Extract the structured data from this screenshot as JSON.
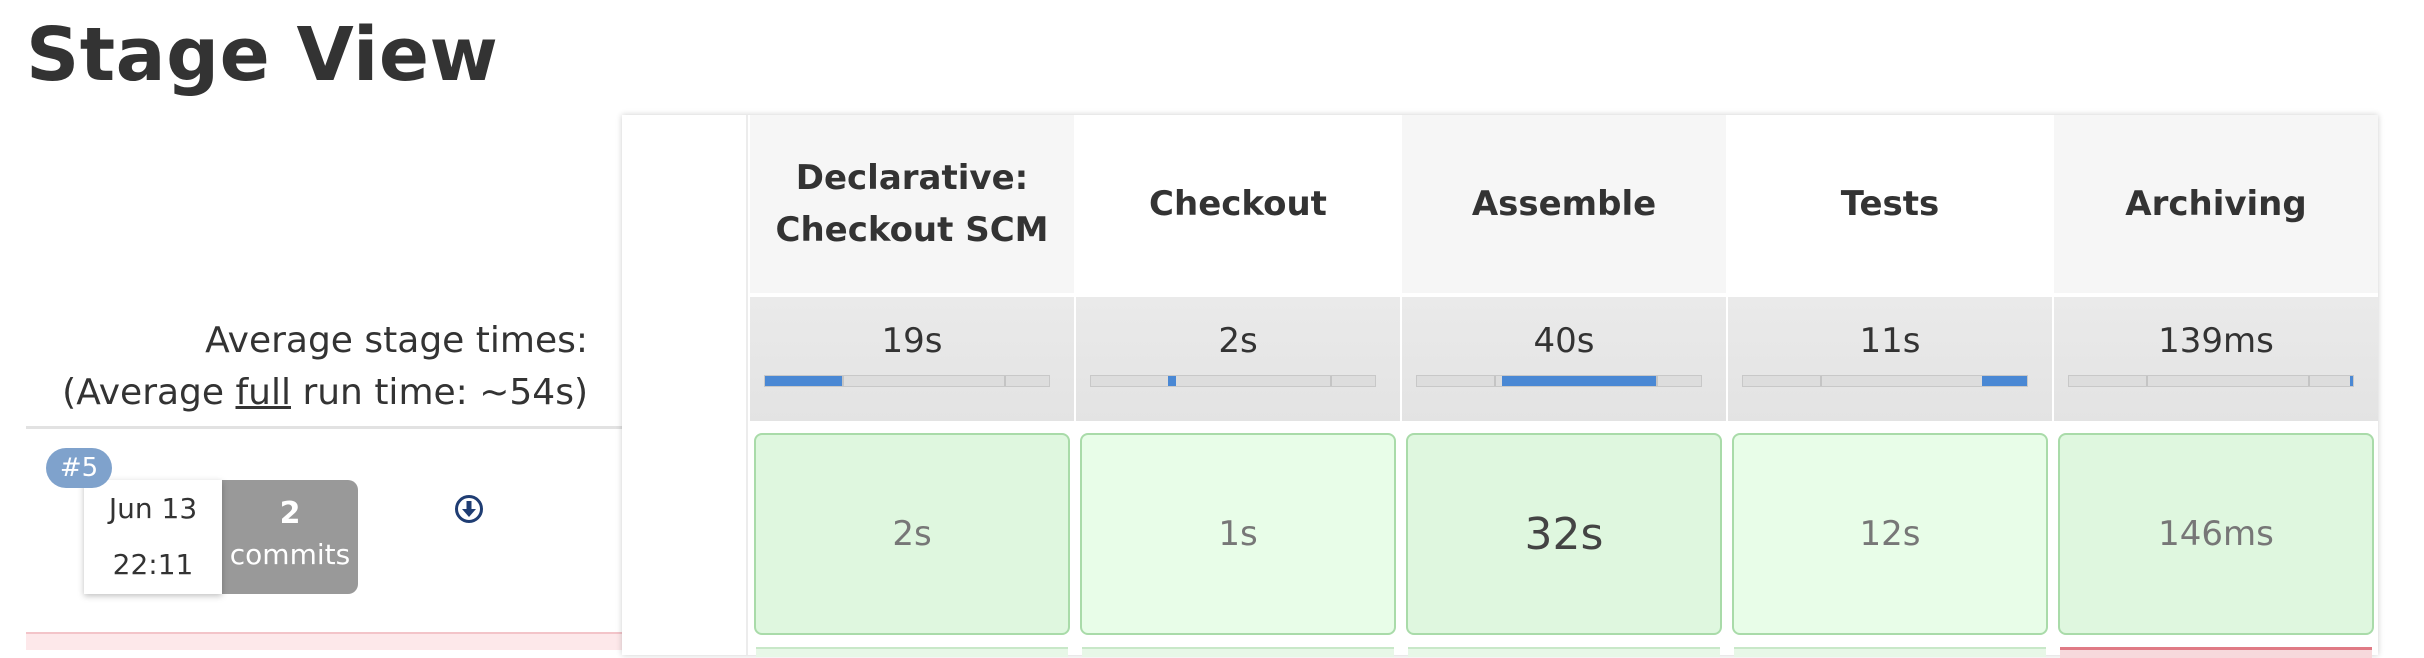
{
  "page": {
    "title": "Stage View"
  },
  "summary": {
    "avg_stage_label": "Average stage times:",
    "avg_run_prefix": "(Average ",
    "avg_run_link": "full",
    "avg_run_suffix": " run time: ~54s)"
  },
  "build": {
    "badge": "#5",
    "date": "Jun 13",
    "time": "22:11",
    "commit_count": "2",
    "commit_label": "commits",
    "download_icon": "download-circle-icon"
  },
  "stages": [
    {
      "name": "Declarative: Checkout SCM",
      "line1": "Declarative:",
      "line2": "Checkout SCM",
      "avg": "19s",
      "bar_start": 0.0,
      "bar_fraction": 0.27,
      "run": "2s"
    },
    {
      "name": "Checkout",
      "line1": "Checkout",
      "line2": "",
      "avg": "2s",
      "bar_start": 0.27,
      "bar_fraction": 0.03,
      "run": "1s"
    },
    {
      "name": "Assemble",
      "line1": "Assemble",
      "line2": "",
      "avg": "40s",
      "bar_start": 0.3,
      "bar_fraction": 0.54,
      "run": "32s"
    },
    {
      "name": "Tests",
      "line1": "Tests",
      "line2": "",
      "avg": "11s",
      "bar_start": 0.84,
      "bar_fraction": 0.16,
      "run": "12s"
    },
    {
      "name": "Archiving",
      "line1": "Archiving",
      "line2": "",
      "avg": "139ms",
      "bar_start": 0.99,
      "bar_fraction": 0.01,
      "run": "146ms"
    }
  ],
  "colors": {
    "progress_fill": "#4a88d4",
    "success_cell": "#dff7df",
    "success_border": "#a9dba9",
    "failure_accent": "#e07a85",
    "badge": "#7fa2cc",
    "commits_bg": "#999999"
  }
}
